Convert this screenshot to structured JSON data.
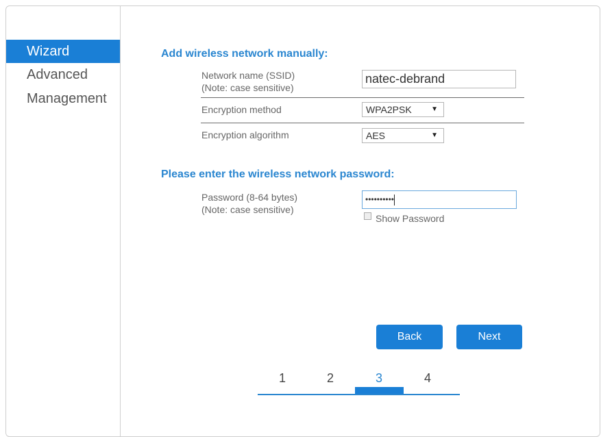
{
  "sidebar": {
    "items": [
      {
        "label": "Wizard",
        "active": true
      },
      {
        "label": "Advanced",
        "active": false
      },
      {
        "label": "Management",
        "active": false
      }
    ]
  },
  "network_section": {
    "title": "Add wireless network manually:",
    "ssid_label_line1": "Network name (SSID)",
    "ssid_label_line2": "(Note: case sensitive)",
    "ssid_value": "natec-debrand",
    "encryption_method_label": "Encryption method",
    "encryption_method_value": "WPA2PSK",
    "encryption_algorithm_label": "Encryption algorithm",
    "encryption_algorithm_value": "AES"
  },
  "password_section": {
    "title": "Please enter the wireless network password:",
    "password_label_line1": "Password (8-64 bytes)",
    "password_label_line2": "(Note: case sensitive)",
    "password_masked": "••••••••••",
    "show_password_label": "Show Password",
    "show_password_checked": false
  },
  "buttons": {
    "back_label": "Back",
    "next_label": "Next"
  },
  "steps": {
    "items": [
      "1",
      "2",
      "3",
      "4"
    ],
    "current": "3"
  },
  "colors": {
    "accent": "#1a7fd6",
    "title_blue": "#2a86d0"
  }
}
